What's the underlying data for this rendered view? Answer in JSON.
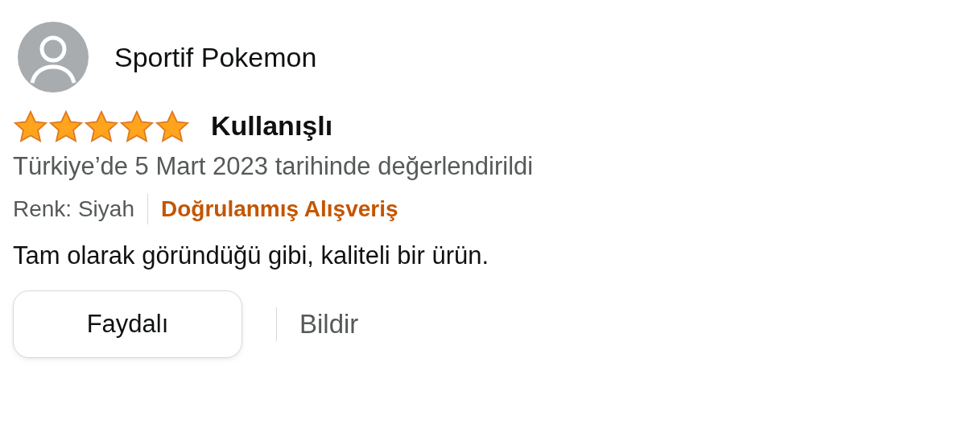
{
  "review": {
    "author": "Sportif Pokemon",
    "stars": 5,
    "title": "Kullanışlı",
    "date": "Türkiye’de 5 Mart 2023 tarihinde değerlendirildi",
    "variant": "Renk: Siyah",
    "verified": "Doğrulanmış Alışveriş",
    "body": "Tam olarak göründüğü gibi, kaliteli bir ürün.",
    "helpful_button": "Faydalı",
    "report_link": "Bildir"
  }
}
